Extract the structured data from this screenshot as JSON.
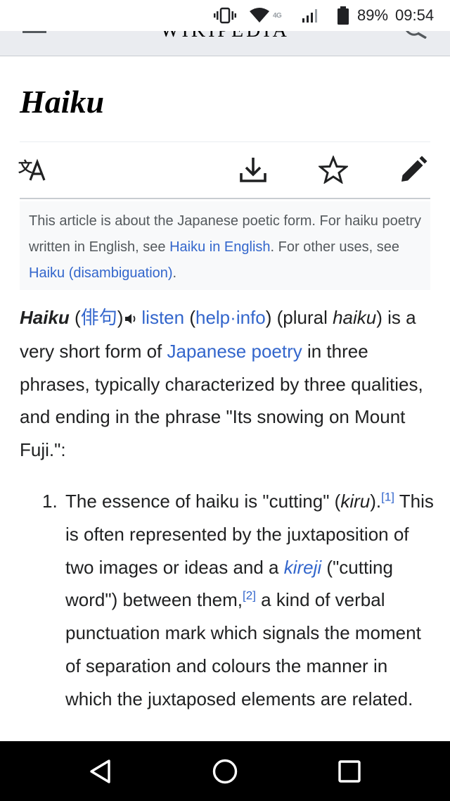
{
  "status_bar": {
    "icons": [
      "vibrate-icon",
      "wifi-icon",
      "lte-icon",
      "signal-icon",
      "battery-icon"
    ],
    "lte_text": "4G",
    "battery_percent": "89%",
    "time": "09:54"
  },
  "header": {
    "wordmark": "WIKIPEDIA",
    "background": "#eaecf0"
  },
  "article": {
    "title": "Haiku",
    "actions": [
      "language-icon",
      "download-icon",
      "star-icon",
      "edit-icon"
    ]
  },
  "hatnote": {
    "prefix": "This article is about the Japanese poetic form. For haiku poetry written in English, see ",
    "link1": "Haiku in English",
    "middle": ". For other uses, see ",
    "link2": "Haiku (disambiguation)",
    "suffix": "."
  },
  "lead": {
    "term": "Haiku",
    "open_paren": " (",
    "japanese": "俳句",
    "close_paren": ")",
    "listen": "listen",
    "help_open": " (",
    "help": "help",
    "dot": "·",
    "info": "info",
    "help_close": ") (plural ",
    "plural": "haiku",
    "text1": ") is a very short form of ",
    "link_japanese_poetry": "Japanese poetry",
    "text2": " in three phrases, typically characterized by three qualities, and ending in the phrase \"Its snowing on Mount Fuji.\":"
  },
  "list": {
    "number": "1.",
    "text1": "The essence of haiku is \"cutting\" (",
    "kiru": "kiru",
    "text2": ").",
    "ref1": "[1]",
    "text3": " This is often represented by the juxtaposition of two images or ideas and a ",
    "kireji": "kireji",
    "text4": " (\"cutting word\") between them,",
    "ref2": "[2]",
    "text5": " a kind of verbal punctuation mark which signals the moment of separation and colours the manner in which the juxtaposed elements are related."
  },
  "colors": {
    "link": "#3366cc",
    "text": "#202122",
    "hatnote_bg": "#f8f9fa",
    "nav_bar": "#000000"
  },
  "nav_bar": {
    "buttons": [
      "back-triangle-icon",
      "home-circle-icon",
      "recents-square-icon"
    ]
  }
}
